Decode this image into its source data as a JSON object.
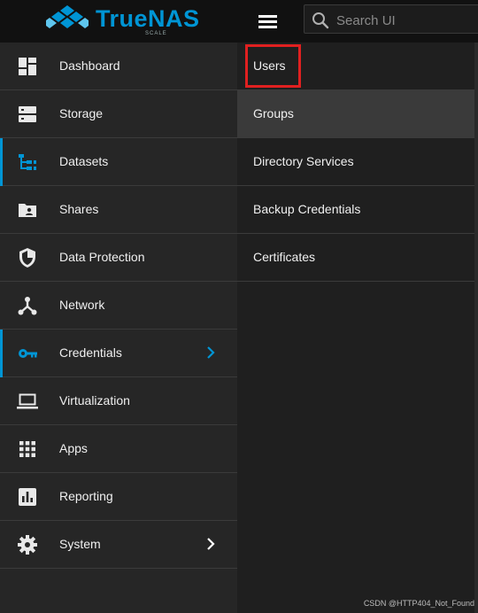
{
  "brand": {
    "name": "TrueNAS",
    "subtitle": "SCALE"
  },
  "search": {
    "placeholder": "Search UI"
  },
  "sidebar": {
    "items": [
      {
        "label": "Dashboard",
        "icon": "dashboard-icon"
      },
      {
        "label": "Storage",
        "icon": "storage-icon"
      },
      {
        "label": "Datasets",
        "icon": "datasets-icon"
      },
      {
        "label": "Shares",
        "icon": "shares-icon"
      },
      {
        "label": "Data Protection",
        "icon": "shield-icon"
      },
      {
        "label": "Network",
        "icon": "network-icon"
      },
      {
        "label": "Credentials",
        "icon": "key-icon"
      },
      {
        "label": "Virtualization",
        "icon": "laptop-icon"
      },
      {
        "label": "Apps",
        "icon": "apps-grid-icon"
      },
      {
        "label": "Reporting",
        "icon": "reporting-icon"
      },
      {
        "label": "System",
        "icon": "gear-icon"
      }
    ]
  },
  "submenu": {
    "items": [
      {
        "label": "Users"
      },
      {
        "label": "Groups"
      },
      {
        "label": "Directory Services"
      },
      {
        "label": "Backup Credentials"
      },
      {
        "label": "Certificates"
      }
    ]
  },
  "watermark": "CSDN @HTTP404_Not_Found",
  "colors": {
    "accent": "#0095d5",
    "highlight": "#e02020",
    "sidebar_bg": "#262626",
    "topbar_bg": "#111111"
  }
}
